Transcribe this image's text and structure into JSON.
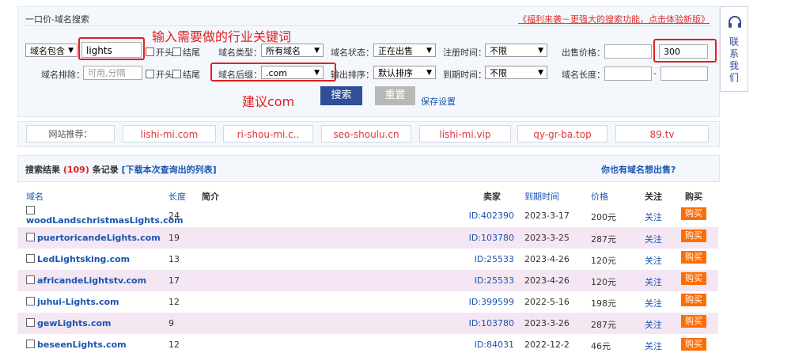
{
  "search_panel": {
    "title": "一口价-域名搜索",
    "promo_link": "《福利来袭－更强大的搜索功能，点击体验新版》",
    "domain_match_select": "域名包含",
    "keyword_value": "lights",
    "chk_start": "开头",
    "chk_end": "结尾",
    "type_label": "域名类型：",
    "type_select": "所有域名",
    "status_label": "域名状态：",
    "status_select": "正在出售",
    "reg_label": "注册时间：",
    "reg_select": "不限",
    "price_label": "出售价格：",
    "price_min": "",
    "price_max": "300",
    "exclude_label": "域名排除：",
    "exclude_placeholder": "可用,分隔",
    "suffix_label": "域名后缀：",
    "suffix_select": ".com",
    "sort_label": "输出排序：",
    "sort_select": "默认排序",
    "expire_label": "到期时间：",
    "expire_select": "不限",
    "length_label": "域名长度：",
    "length_sep": "-",
    "search_button": "搜索",
    "reset_button": "重置",
    "save_link": "保存设置"
  },
  "annotations": {
    "keyword_hint": "输入需要做的行业关键词",
    "suffix_hint": "建议com"
  },
  "recommend": {
    "label": "网站推荐：",
    "sites": [
      "lishi-mi.com",
      "ri-shou-mi.c..",
      "seo-shoulu.cn",
      "lishi-mi.vip",
      "qy-gr-ba.top",
      "89.tv"
    ]
  },
  "results": {
    "prefix": "搜索结果",
    "count": "(109)",
    "suffix": "条记录",
    "download_link": "[下载本次查询出的列表]",
    "sell_link": "你也有域名想出售?",
    "headers": {
      "domain": "域名",
      "length": "长度",
      "intro": "简介",
      "seller": "卖家",
      "expire": "到期时间",
      "price": "价格",
      "follow": "关注",
      "buy": "购买"
    },
    "rows": [
      {
        "domain": "woodLandschristmasLights.com",
        "length": "24",
        "seller": "ID:402390",
        "expire": "2023-3-17",
        "price": "200元",
        "follow": "关注",
        "buy": "购买"
      },
      {
        "domain": "puertoricandeLights.com",
        "length": "19",
        "seller": "ID:103780",
        "expire": "2023-3-25",
        "price": "287元",
        "follow": "关注",
        "buy": "购买"
      },
      {
        "domain": "LedLightsking.com",
        "length": "13",
        "seller": "ID:25533",
        "expire": "2023-4-26",
        "price": "120元",
        "follow": "关注",
        "buy": "购买"
      },
      {
        "domain": "africandeLightstv.com",
        "length": "17",
        "seller": "ID:25533",
        "expire": "2023-4-26",
        "price": "120元",
        "follow": "关注",
        "buy": "购买"
      },
      {
        "domain": "juhui-Lights.com",
        "length": "12",
        "seller": "ID:399599",
        "expire": "2022-5-16",
        "price": "198元",
        "follow": "关注",
        "buy": "购买"
      },
      {
        "domain": "gewLights.com",
        "length": "9",
        "seller": "ID:103780",
        "expire": "2023-3-26",
        "price": "287元",
        "follow": "关注",
        "buy": "购买"
      },
      {
        "domain": "beseenLights.com",
        "length": "12",
        "seller": "ID:84031",
        "expire": "2022-12-2",
        "price": "46元",
        "follow": "关注",
        "buy": "购买"
      }
    ]
  },
  "contact": {
    "icon": "headset-icon",
    "label_1": "联",
    "label_2": "系",
    "label_3": "我",
    "label_4": "们"
  },
  "colors": {
    "accent_blue": "#1a55b0",
    "button_blue": "#2f4f97",
    "buy_orange": "#ff6c00",
    "annotation_red": "#e02020",
    "alt_row": "#f5e6f3"
  }
}
